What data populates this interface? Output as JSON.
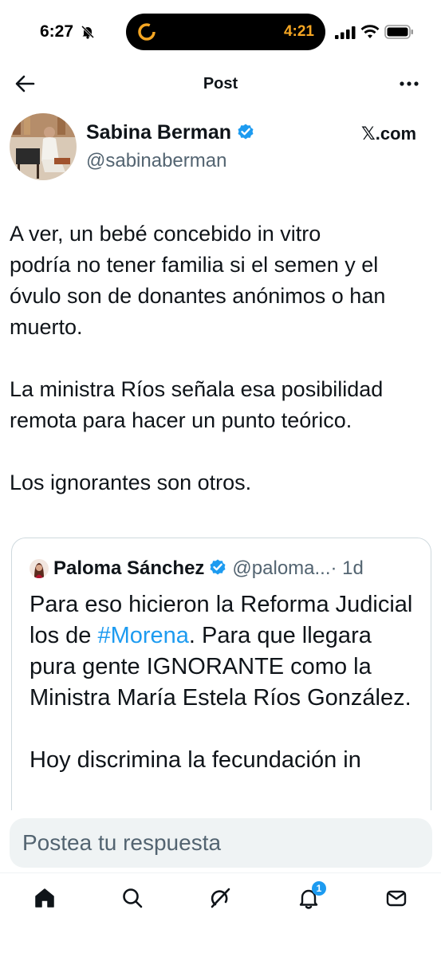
{
  "status_bar": {
    "time": "6:27",
    "timer": "4:21",
    "icons": [
      "bell-slash-icon",
      "timer-icon",
      "signal-icon",
      "wifi-icon",
      "battery-icon"
    ]
  },
  "header": {
    "title": "Post",
    "back_icon": "arrow-left-icon",
    "more_icon": "more-horizontal-icon"
  },
  "author": {
    "name": "Sabina Berman",
    "handle": "@sabinaberman",
    "verified": true,
    "source": "𝕏.com"
  },
  "tweet": {
    "paragraphs": [
      "A ver, un bebé concebido in vitro\npodría no tener familia si el semen y el\nóvulo son de donantes anónimos o han\nmuerto.",
      "La ministra Ríos señala esa posibilidad\nremota para hacer un punto teórico.",
      "Los ignorantes son otros."
    ]
  },
  "quote": {
    "name": "Paloma Sánchez",
    "handle": "@paloma...",
    "time": "· 1d",
    "text_before": "Para eso hicieron la Reforma Judicial los de ",
    "hashtag": "#Morena",
    "text_after": ". Para que llegara pura gente IGNORANTE como la Ministra María Estela Ríos González.",
    "text_second": "Hoy discrimina la fecundación in"
  },
  "reply": {
    "placeholder": "Postea tu respuesta"
  },
  "tab_bar": {
    "items": [
      "home-icon",
      "search-icon",
      "grok-icon",
      "notifications-icon",
      "messages-icon"
    ],
    "notification_count": "1"
  },
  "colors": {
    "accent": "#1d9bf0",
    "text": "#0f1419",
    "secondary": "#536471",
    "timer": "#f5a623"
  }
}
